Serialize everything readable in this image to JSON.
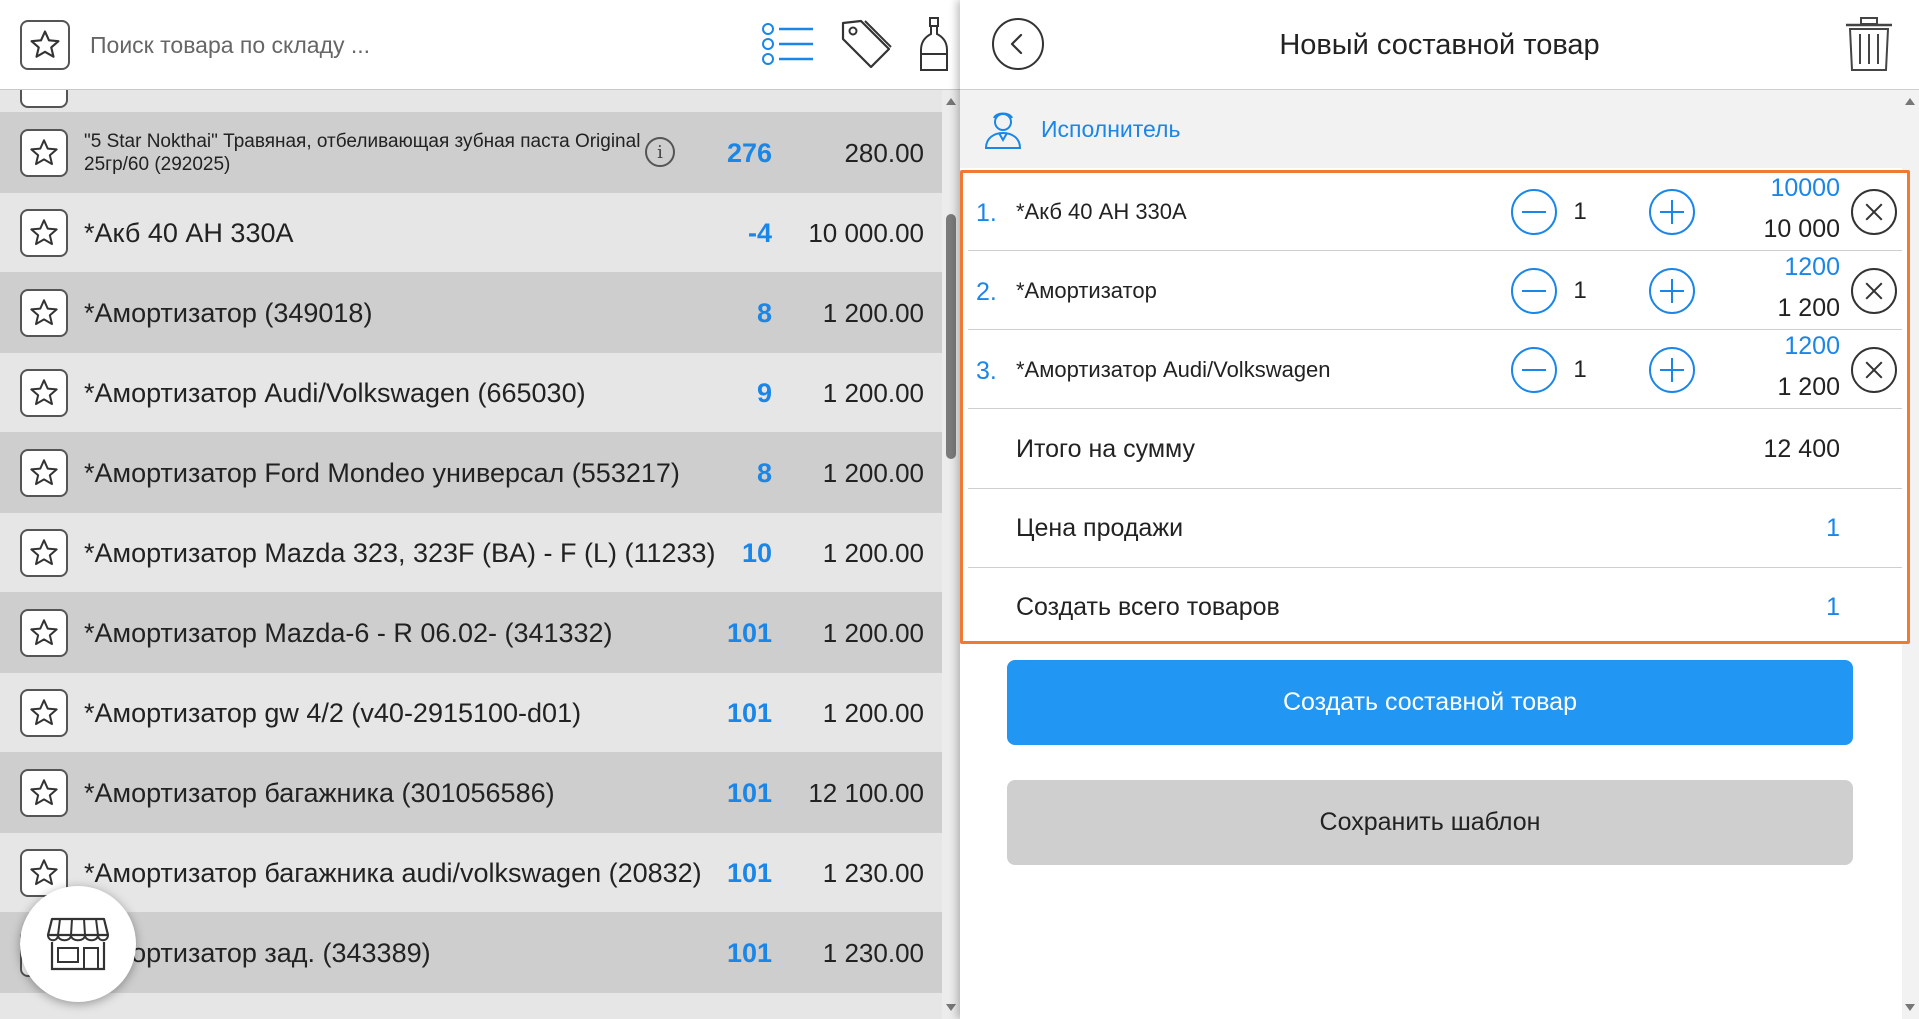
{
  "search": {
    "placeholder": "Поиск товара по складу ..."
  },
  "products": [
    {
      "name": "\"5 Star Nokthai\" Травяная, отбеливающая зубная паста Original 25гр/60 (292025)",
      "qty": "276",
      "price": "280.00",
      "info": "i"
    },
    {
      "name": "*Акб 40 АН 330А",
      "qty": "-4",
      "price": "10 000.00"
    },
    {
      "name": "*Амортизатор (349018)",
      "qty": "8",
      "price": "1 200.00"
    },
    {
      "name": "*Амортизатор Audi/Volkswagen (665030)",
      "qty": "9",
      "price": "1 200.00"
    },
    {
      "name": "*Амортизатор Ford Mondeo универсал (553217)",
      "qty": "8",
      "price": "1 200.00"
    },
    {
      "name": "*Амортизатор Mazda 323, 323F (BA) - F (L) (11233)",
      "qty": "10",
      "price": "1 200.00"
    },
    {
      "name": "*Амортизатор Mazda-6 - R 06.02- (341332)",
      "qty": "101",
      "price": "1 200.00"
    },
    {
      "name": "*Амортизатор gw 4/2 (v40-2915100-d01)",
      "qty": "101",
      "price": "1 200.00"
    },
    {
      "name": "*Амортизатор багажника (301056586)",
      "qty": "101",
      "price": "12 100.00"
    },
    {
      "name": "*Амортизатор багажника audi/volkswagen (20832)",
      "qty": "101",
      "price": "1 230.00"
    },
    {
      "name": "*Амортизатор зад. (343389)",
      "qty": "101",
      "price": "1 230.00"
    }
  ],
  "panel": {
    "title": "Новый составной товар",
    "executor_label": "Исполнитель"
  },
  "components": [
    {
      "num": "1.",
      "name": "*Акб 40 АН 330А",
      "qty": "1",
      "price": "10000",
      "total": "10 000"
    },
    {
      "num": "2.",
      "name": "*Амортизатор",
      "qty": "1",
      "price": "1200",
      "total": "1 200"
    },
    {
      "num": "3.",
      "name": "*Амортизатор Audi/Volkswagen",
      "qty": "1",
      "price": "1200",
      "total": "1 200"
    }
  ],
  "summary": {
    "total_label": "Итого на сумму",
    "total_value": "12 400",
    "sale_price_label": "Цена продажи",
    "sale_price_value": "1",
    "create_count_label": "Создать всего товаров",
    "create_count_value": "1"
  },
  "buttons": {
    "create": "Создать составной товар",
    "save_template": "Сохранить шаблон"
  },
  "colors": {
    "accent": "#1a86e8",
    "primary_button": "#2196f3",
    "highlight_border": "#f07a34"
  }
}
